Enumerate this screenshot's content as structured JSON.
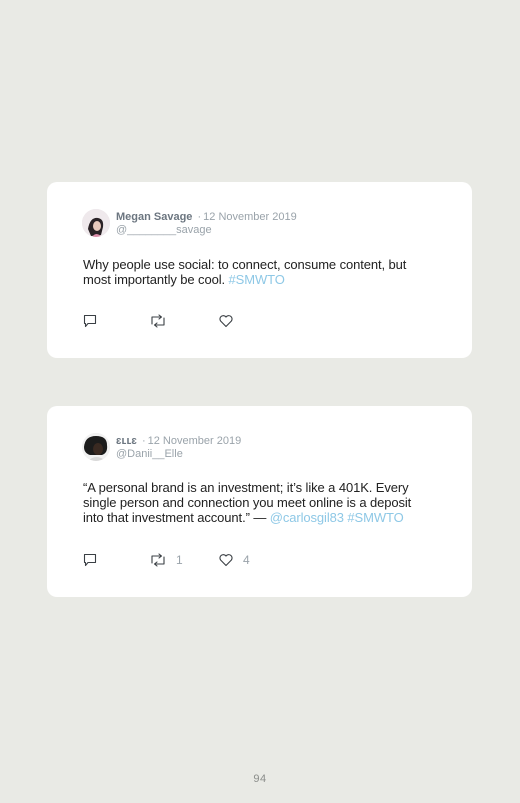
{
  "tweets": [
    {
      "name": "Megan Savage",
      "separator": "·",
      "date": "12 November 2019",
      "handle": "@________savage",
      "text": "Why people use social: to connect, consume content, but most importantly be cool.",
      "link1": "#SMWTO",
      "link2": "",
      "retweet_count": "",
      "like_count": ""
    },
    {
      "name": "ɛʟʟɛ",
      "separator": "·",
      "date": "12 November 2019",
      "handle": "@Danii__Elle",
      "text": "“A personal brand is an investment; it’s like a 401K. Every single person and connection you meet online is a deposit into that investment account.” —",
      "link1": "@carlosgil83",
      "link2": "#SMWTO",
      "retweet_count": "1",
      "like_count": "4"
    }
  ],
  "icons": {
    "reply": "speech-bubble-icon",
    "retweet": "retweet-arrows-icon",
    "like": "heart-icon"
  },
  "colors": {
    "background": "#e9eae5",
    "card": "#ffffff",
    "link": "#8ec8e6",
    "meta": "#9aa3aa"
  },
  "page_number": "94"
}
